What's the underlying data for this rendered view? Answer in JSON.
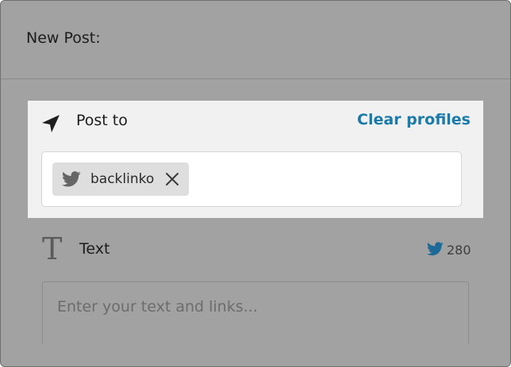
{
  "header": {
    "title": "New Post:"
  },
  "post_to": {
    "label": "Post to",
    "clear_label": "Clear profiles",
    "icon": "send-icon",
    "profiles": [
      {
        "name": "backlinko",
        "network": "twitter-icon",
        "remove_icon": "close-icon"
      }
    ]
  },
  "text_section": {
    "label": "Text",
    "icon": "text-T-icon",
    "char_limit": "280",
    "char_limit_icon": "twitter-icon",
    "placeholder": "Enter your text and links..."
  },
  "colors": {
    "accent": "#1a7bab",
    "overlay": "#a2a2a2",
    "card": "#f1f1f1",
    "twitter": "#1d8fd0"
  }
}
